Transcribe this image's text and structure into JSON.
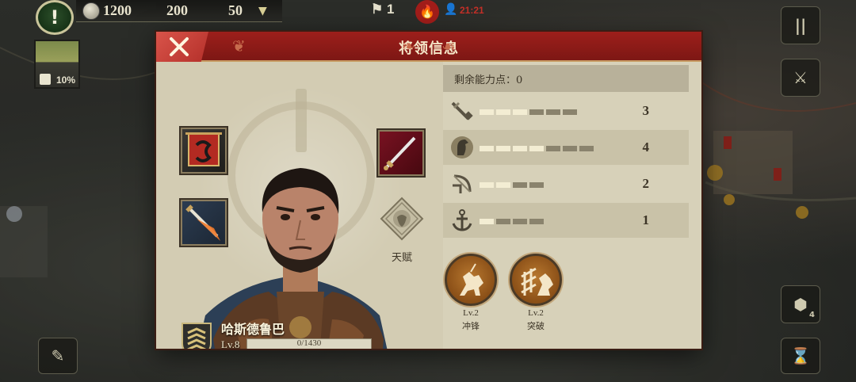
{
  "hud": {
    "alert": "!",
    "resource1": "1200",
    "resource2": "200",
    "resource3": "50",
    "center_count": "1",
    "red_text": "21:21"
  },
  "map_thumb": {
    "percent": "10%"
  },
  "side_buttons": {
    "pause": "||",
    "count": "4"
  },
  "dialog": {
    "title": "将领信息",
    "talent_label": "天赋"
  },
  "general": {
    "name": "哈斯德鲁巴",
    "level": "Lv.8",
    "xp_text": "0/1430",
    "xp_progress": 0
  },
  "stats": {
    "remaining_points": "剩余能力点：0",
    "items": [
      {
        "icon": "sword-icon",
        "value": "3",
        "level": 3,
        "max": 6
      },
      {
        "icon": "horse-icon",
        "value": "4",
        "level": 4,
        "max": 7
      },
      {
        "icon": "bow-icon",
        "value": "2",
        "level": 2,
        "max": 4
      },
      {
        "icon": "anchor-icon",
        "value": "1",
        "level": 1,
        "max": 4
      }
    ]
  },
  "skills": [
    {
      "level": "Lv.2",
      "name": "冲锋"
    },
    {
      "level": "Lv.2",
      "name": "突破"
    }
  ],
  "colors": {
    "header_red": "#9d1f1b",
    "panel": "#d7d1b9",
    "close_red": "#d9544a",
    "skill_bronze": "#b8782f"
  }
}
